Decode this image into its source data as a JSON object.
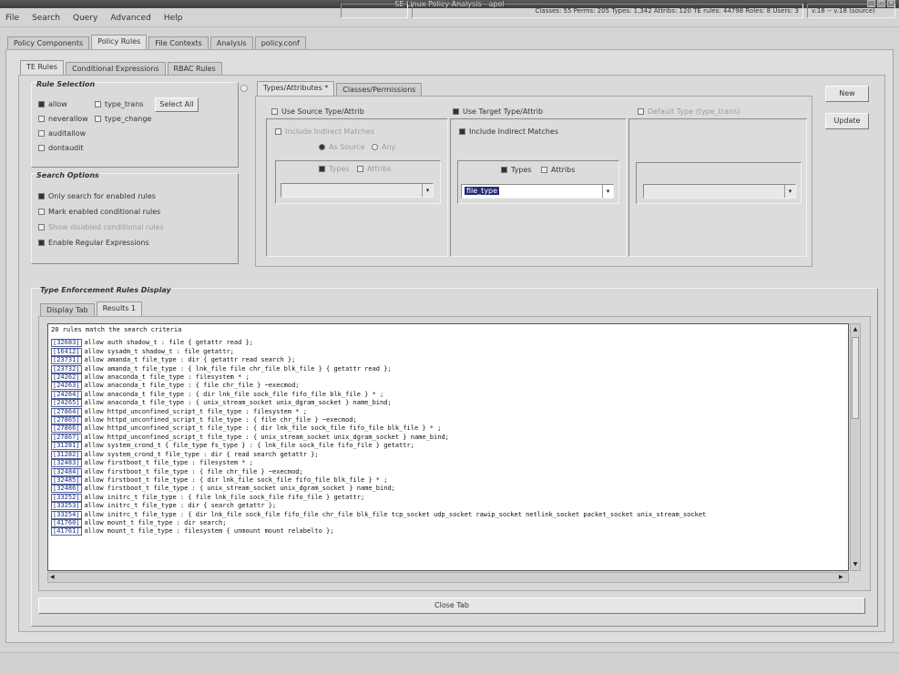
{
  "window": {
    "title": "SE Linux Policy Analysis - apol",
    "buttons": [
      "_",
      "□",
      "×"
    ]
  },
  "menu": [
    "File",
    "Search",
    "Query",
    "Advanced",
    "Help"
  ],
  "main_tabs": [
    "Policy Components",
    "Policy Rules",
    "File Contexts",
    "Analysis",
    "policy.conf"
  ],
  "sub_tabs": [
    "TE Rules",
    "Conditional Expressions",
    "RBAC Rules"
  ],
  "rule_selection": {
    "title": "Rule Selection",
    "options": [
      {
        "label": "allow",
        "checked": true
      },
      {
        "label": "type_trans",
        "checked": false
      },
      {
        "label": "neverallow",
        "checked": false
      },
      {
        "label": "type_change",
        "checked": false
      },
      {
        "label": "auditallow",
        "checked": false
      },
      {
        "label": "dontaudit",
        "checked": false
      }
    ],
    "select_all": "Select All"
  },
  "search_options": {
    "title": "Search Options",
    "options": [
      {
        "label": "Only search for enabled rules",
        "checked": true,
        "disabled": false
      },
      {
        "label": "Mark enabled conditional rules",
        "checked": false,
        "disabled": false
      },
      {
        "label": "Show disabled conditional rules",
        "checked": false,
        "disabled": true
      },
      {
        "label": "Enable Regular Expressions",
        "checked": true,
        "disabled": false
      }
    ]
  },
  "criteria_tabs": [
    "Types/Attributes *",
    "Classes/Permissions"
  ],
  "source": {
    "header": "Use Source Type/Attrib",
    "include_indirect": "Include Indirect Matches",
    "as_source": "As Source",
    "any": "Any",
    "types": "Types",
    "attribs": "Attribs",
    "value": ""
  },
  "target": {
    "header": "Use Target Type/Attrib",
    "include_indirect": "Include Indirect Matches",
    "types": "Types",
    "attribs": "Attribs",
    "value": "file_type"
  },
  "default": {
    "header": "Default Type (type_trans)",
    "value": ""
  },
  "actions": {
    "new": "New",
    "update": "Update"
  },
  "results_display": {
    "title": "Type Enforcement Rules Display",
    "tabs": [
      "Display Tab",
      "Results 1"
    ],
    "summary": "20 rules match the search criteria",
    "rules": [
      {
        "id": "[32683]",
        "text": "allow auth shadow_t : file { getattr read };"
      },
      {
        "id": "[16412]",
        "text": "allow sysadm_t shadow_t : file getattr;"
      },
      {
        "id": "[23731]",
        "text": "allow amanda_t file_type : dir { getattr read search };"
      },
      {
        "id": "[23732]",
        "text": "allow amanda_t file_type : { lnk_file file chr_file blk_file } { getattr read };"
      },
      {
        "id": "[24262]",
        "text": "allow anaconda_t file_type : filesystem * ;"
      },
      {
        "id": "[24263]",
        "text": "allow anaconda_t file_type : { file chr_file } ~execmod;"
      },
      {
        "id": "[24264]",
        "text": "allow anaconda_t file_type : { dir lnk_file sock_file fifo_file blk_file } * ;"
      },
      {
        "id": "[24265]",
        "text": "allow anaconda_t file_type : { unix_stream_socket unix_dgram_socket } name_bind;"
      },
      {
        "id": "[27864]",
        "text": "allow httpd_unconfined_script_t file_type : filesystem * ;"
      },
      {
        "id": "[27865]",
        "text": "allow httpd_unconfined_script_t file_type : { file chr_file } ~execmod;"
      },
      {
        "id": "[27866]",
        "text": "allow httpd_unconfined_script_t file_type : { dir lnk_file sock_file fifo_file blk_file } * ;"
      },
      {
        "id": "[27867]",
        "text": "allow httpd_unconfined_script_t file_type : { unix_stream_socket unix_dgram_socket } name_bind;"
      },
      {
        "id": "[31281]",
        "text": "allow system_crond_t { file_type fs_type } : { lnk_file sock_file fifo_file } getattr;"
      },
      {
        "id": "[31282]",
        "text": "allow system_crond_t file_type : dir { read search getattr };"
      },
      {
        "id": "[32483]",
        "text": "allow firstboot_t file_type : filesystem * ;"
      },
      {
        "id": "[32484]",
        "text": "allow firstboot_t file_type : { file chr_file } ~execmod;"
      },
      {
        "id": "[32485]",
        "text": "allow firstboot_t file_type : { dir lnk_file sock_file fifo_file blk_file } * ;"
      },
      {
        "id": "[32486]",
        "text": "allow firstboot_t file_type : { unix_stream_socket unix_dgram_socket } name_bind;"
      },
      {
        "id": "[33252]",
        "text": "allow initrc_t file_type : { file lnk_file sock_file fifo_file } getattr;"
      },
      {
        "id": "[33253]",
        "text": "allow initrc_t file_type : dir { search getattr };"
      },
      {
        "id": "[33254]",
        "text": "allow initrc_t file_type : { dir lnk_file sock_file fifo_file chr_file blk_file tcp_socket udp_socket rawip_socket netlink_socket packet_socket unix_stream_socket"
      },
      {
        "id": "[41760]",
        "text": "allow mount_t file_type : dir search;"
      },
      {
        "id": "[41761]",
        "text": "allow mount_t file_type : filesystem { unmount mount relabelto };"
      }
    ],
    "close_tab": "Close Tab"
  },
  "status": {
    "stats": "Classes: 55   Perms: 205   Types: 1,342   Attribs: 120   TE rules: 44798   Roles: 8   Users: 3",
    "version": "v.18 -- v.18 (source)"
  }
}
